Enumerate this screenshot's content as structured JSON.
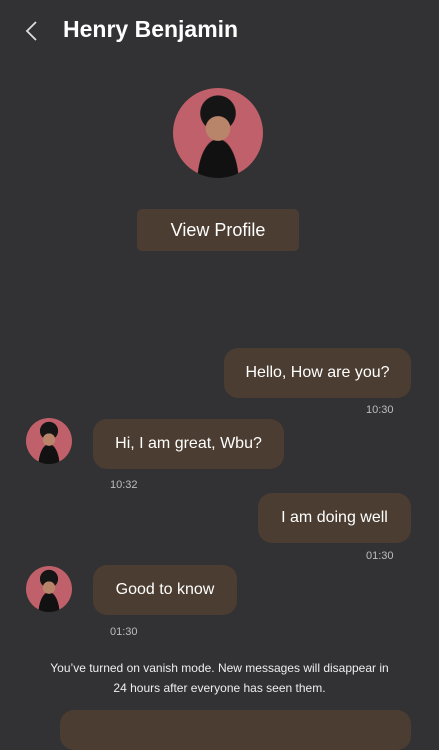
{
  "header": {
    "title": "Henry Benjamin"
  },
  "profile": {
    "view_profile_label": "View Profile"
  },
  "messages": [
    {
      "from": "me",
      "text": "Hello, How are you?",
      "time": "10:30"
    },
    {
      "from": "them",
      "text": "Hi, I am great, Wbu?",
      "time": "10:32"
    },
    {
      "from": "me",
      "text": "I am doing well",
      "time": "01:30"
    },
    {
      "from": "them",
      "text": "Good to know",
      "time": "01:30"
    }
  ],
  "notice": {
    "line1": "You’ve turned on vanish mode. New messages will disappear in",
    "line2": "24 hours after everyone has seen them."
  }
}
